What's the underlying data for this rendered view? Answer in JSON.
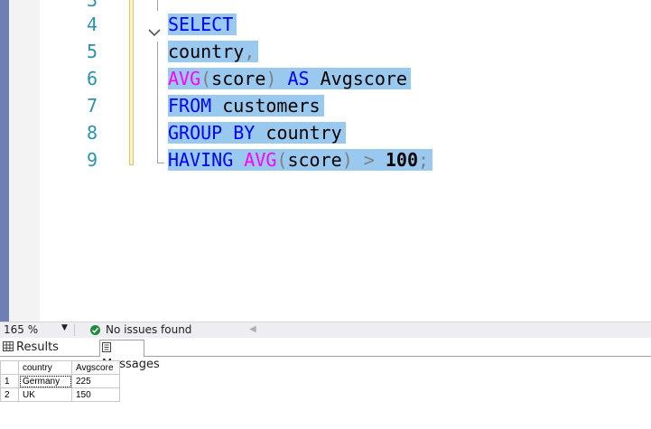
{
  "editor": {
    "line_numbers": [
      "3",
      "4",
      "5",
      "6",
      "7",
      "8",
      "9"
    ],
    "lines": [
      [
        {
          "t": "SELECT",
          "c": "kw"
        }
      ],
      [
        {
          "t": "country",
          "c": "id"
        },
        {
          "t": ",",
          "c": "pn"
        }
      ],
      [
        {
          "t": "AVG",
          "c": "fn"
        },
        {
          "t": "(",
          "c": "pn"
        },
        {
          "t": "score",
          "c": "id"
        },
        {
          "t": ")",
          "c": "pn"
        },
        {
          "t": " ",
          "c": "id"
        },
        {
          "t": "AS",
          "c": "kw"
        },
        {
          "t": " Avgscore",
          "c": "id"
        }
      ],
      [
        {
          "t": "FROM",
          "c": "kw"
        },
        {
          "t": " customers",
          "c": "id"
        }
      ],
      [
        {
          "t": "GROUP",
          "c": "kw"
        },
        {
          "t": " ",
          "c": "id"
        },
        {
          "t": "BY",
          "c": "kw"
        },
        {
          "t": " country",
          "c": "id"
        }
      ],
      [
        {
          "t": "HAVING",
          "c": "kw"
        },
        {
          "t": " ",
          "c": "id"
        },
        {
          "t": "AVG",
          "c": "fn"
        },
        {
          "t": "(",
          "c": "pn"
        },
        {
          "t": "score",
          "c": "id"
        },
        {
          "t": ")",
          "c": "pn"
        },
        {
          "t": " > ",
          "c": "pn"
        },
        {
          "t": "100",
          "c": "nm"
        },
        {
          "t": ";",
          "c": "pn"
        }
      ]
    ],
    "colors": {
      "keyword": "#0000ff",
      "function": "#ff00ff",
      "punctuation": "#808080",
      "selection": "#99c9ef",
      "line_number": "#2b91af"
    }
  },
  "status": {
    "zoom": "165 %",
    "issues": "No issues found"
  },
  "results": {
    "tabs": {
      "results": "Results",
      "messages": "Messages"
    },
    "columns": [
      "country",
      "Avgscore"
    ],
    "rows": [
      {
        "n": "1",
        "cells": [
          "Germany",
          "225"
        ]
      },
      {
        "n": "2",
        "cells": [
          "UK",
          "150"
        ]
      }
    ]
  }
}
